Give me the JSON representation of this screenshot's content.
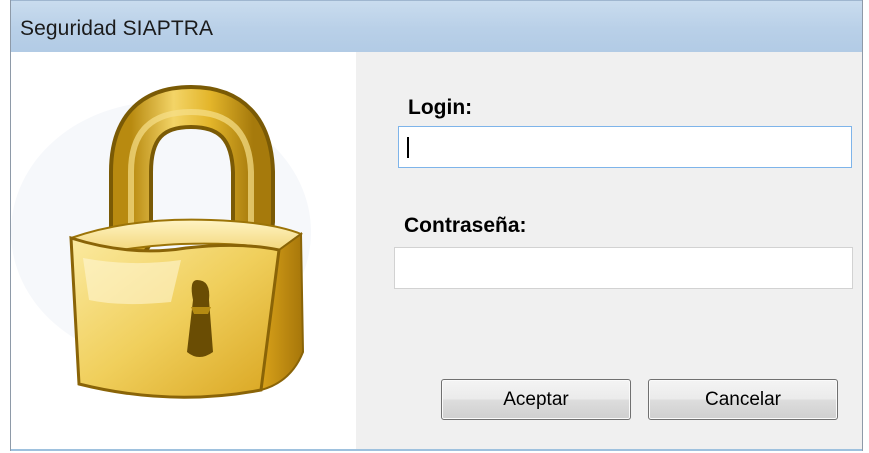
{
  "window": {
    "title": "Seguridad SIAPTRA"
  },
  "form": {
    "login_label": "Login:",
    "login_value": "",
    "password_label": "Contraseña:",
    "password_value": ""
  },
  "buttons": {
    "accept_label": "Aceptar",
    "cancel_label": "Cancelar"
  },
  "icons": {
    "lock": "padlock-icon"
  },
  "colors": {
    "titlebar": "#b9d0e8",
    "lock_gold": "#e6b21c",
    "focus_border": "#7eb4ea"
  }
}
